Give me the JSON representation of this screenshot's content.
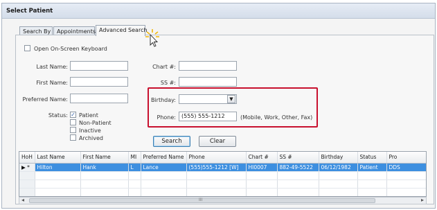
{
  "window": {
    "title": "Select Patient"
  },
  "tabs": [
    {
      "label": "Search By"
    },
    {
      "label": "Appointments"
    },
    {
      "label": "Advanced Search"
    }
  ],
  "form": {
    "keyboard_label": "Open On-Screen Keyboard",
    "last_name_label": "Last Name:",
    "first_name_label": "First Name:",
    "preferred_name_label": "Preferred Name:",
    "status_label": "Status:",
    "chart_label": "Chart #:",
    "ss_label": "SS #:",
    "birthday_label": "Birthday:",
    "phone_label": "Phone:",
    "phone_value": "(555) 555-1212",
    "phone_hint": "(Mobile, Work, Other, Fax)",
    "status_options": [
      {
        "label": "Patient",
        "checked": true
      },
      {
        "label": "Non-Patient",
        "checked": false
      },
      {
        "label": "Inactive",
        "checked": false
      },
      {
        "label": "Archived",
        "checked": false
      }
    ],
    "search_button": "Search",
    "clear_button": "Clear"
  },
  "grid": {
    "columns": [
      "HoH",
      "Last Name",
      "First Name",
      "MI",
      "Preferred Name",
      "Phone",
      "Chart #",
      "SS #",
      "Birthday",
      "Status",
      "Pro"
    ],
    "rows": [
      {
        "marker": "▶",
        "hoh": "*",
        "cells": [
          "Hilton",
          "Hank",
          "L",
          "Lance",
          "(555)555-1212 [W]",
          "HI0007",
          "882-49-5522",
          "06/12/1982",
          "Patient",
          "DDS"
        ]
      }
    ]
  },
  "scrollbar": {
    "left_arrow": "◂",
    "right_arrow": "▸",
    "grip": "III"
  },
  "colors": {
    "highlight": "#c8102e",
    "selection": "#3d8fe0"
  }
}
